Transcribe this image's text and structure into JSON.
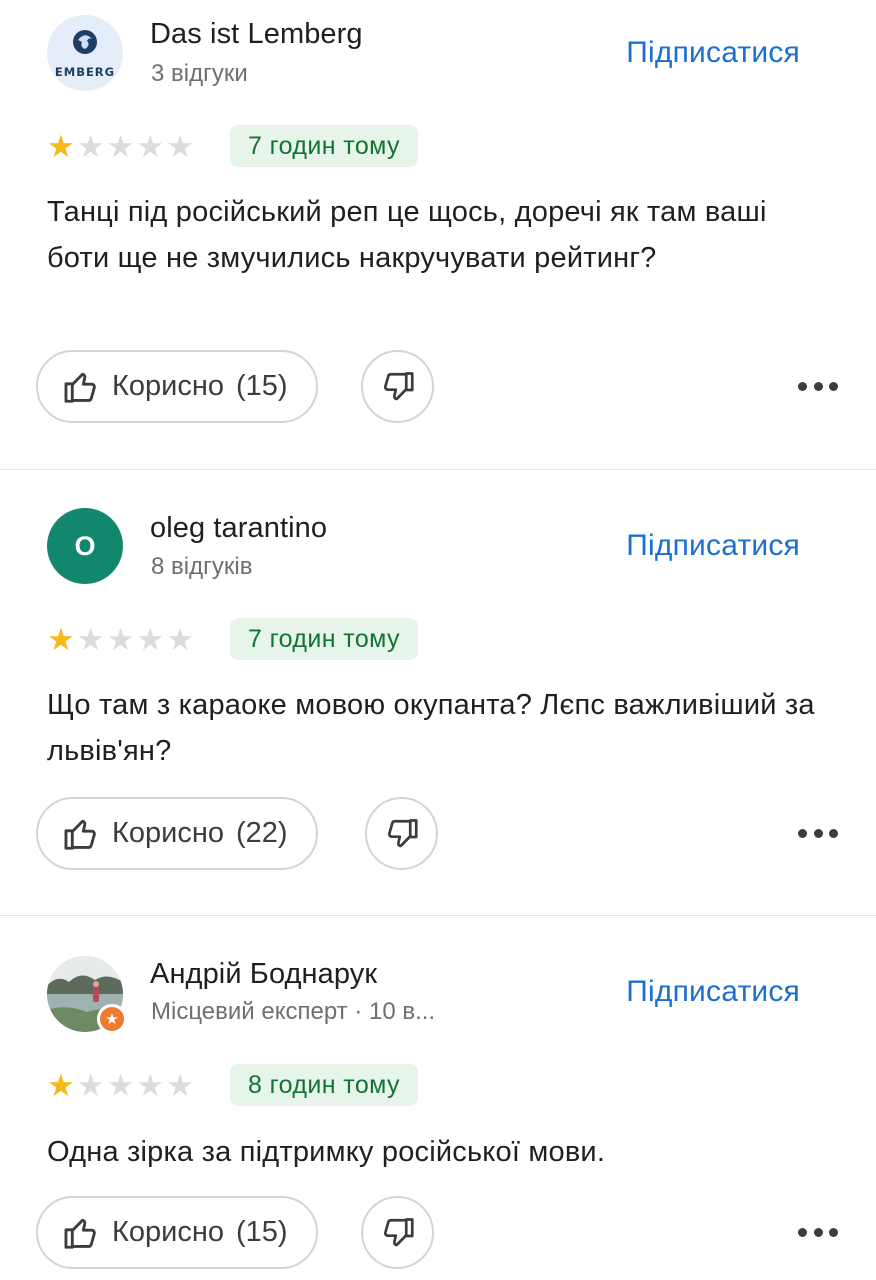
{
  "follow_label": "Підписатися",
  "helpful_label": "Корисно",
  "colors": {
    "accent": "#1a6fd0",
    "star": "#f6b81a",
    "badge_bg": "#e6f4ea",
    "badge_text": "#137333"
  },
  "reviews": [
    {
      "author": "Das ist Lemberg",
      "meta": "3 відгуки",
      "avatar_text": "EMBERG",
      "rating": 1,
      "max_rating": 5,
      "time": "7 годин тому",
      "text": "Танці під російський реп це щось, доречі як там ваші боти ще не змучились накручувати рейтинг?",
      "helpful_count": "(15)"
    },
    {
      "author": "oleg tarantino",
      "meta": "8 відгуків",
      "avatar_text": "O",
      "rating": 1,
      "max_rating": 5,
      "time": "7 годин тому",
      "text": "Що там з караоке мовою окупанта? Лєпс важливіший за львів'ян?",
      "helpful_count": "(22)"
    },
    {
      "author": "Андрій Боднарук",
      "meta": "Місцевий експерт · 10 в...",
      "avatar_text": "",
      "rating": 1,
      "max_rating": 5,
      "time": "8 годин тому",
      "text": "Одна зірка за підтримку російської мови.",
      "helpful_count": "(15)"
    }
  ]
}
